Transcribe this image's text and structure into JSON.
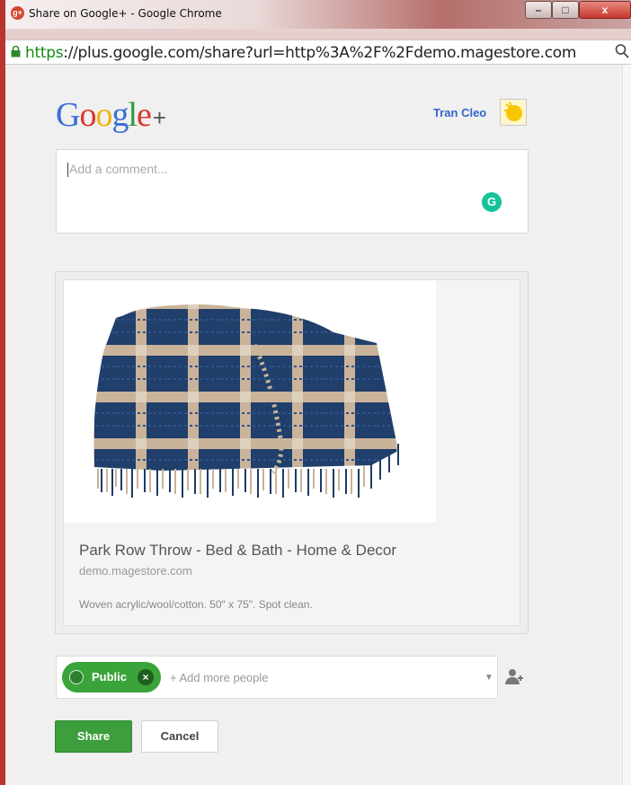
{
  "window": {
    "title": "Share on Google+ - Google Chrome",
    "favicon": "g+",
    "controls": {
      "minimize": "–",
      "maximize": "□",
      "close": "x"
    }
  },
  "address_bar": {
    "scheme": "https",
    "host_path": "://plus.google.com/share?url=http%3A%2F%2Fdemo.magestore.com"
  },
  "header": {
    "logo_letters": [
      "G",
      "o",
      "o",
      "g",
      "l",
      "e"
    ],
    "logo_colors": [
      "#3b6fd7",
      "#d8382c",
      "#f2b20f",
      "#3b6fd7",
      "#2a9a3d",
      "#d8382c"
    ],
    "logo_plus": "+",
    "user_name": "Tran Cleo"
  },
  "comment": {
    "placeholder": "Add a comment..."
  },
  "preview": {
    "title": "Park Row Throw - Bed & Bath - Home & Decor",
    "domain": "demo.magestore.com",
    "description": "Woven acrylic/wool/cotton. 50\" x 75\". Spot clean."
  },
  "audience": {
    "chip_label": "Public",
    "add_placeholder": "+ Add more people"
  },
  "actions": {
    "share": "Share",
    "cancel": "Cancel"
  },
  "colors": {
    "accent_green": "#3d9e3d",
    "link_blue": "#3366cc"
  }
}
